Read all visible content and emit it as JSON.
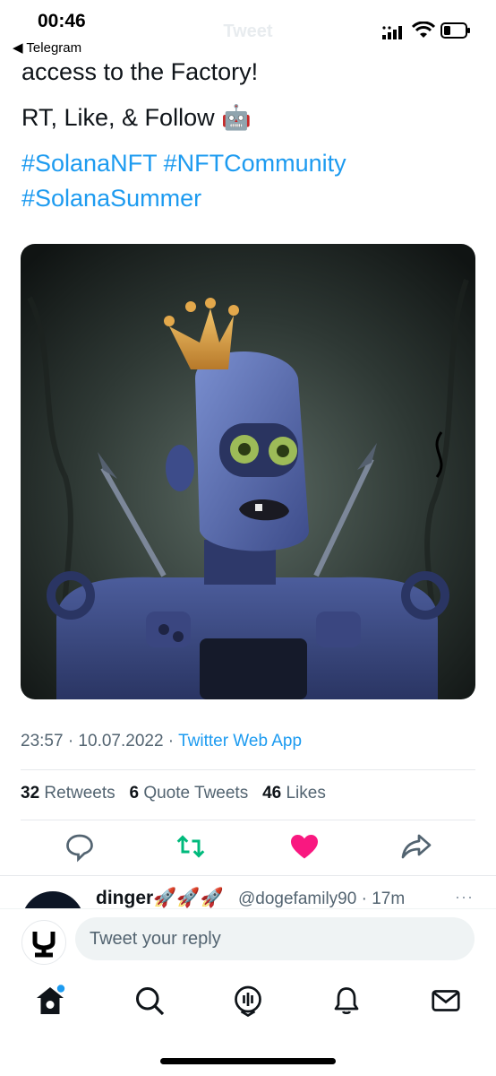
{
  "status_bar": {
    "time": "00:46",
    "back_app": "◀ Telegram",
    "ghost_title": "Tweet"
  },
  "tweet": {
    "lines": [
      "access to the Factory!",
      "RT, Like, & Follow 🤖"
    ],
    "hashtags_line1": "#SolanaNFT #NFTCommunity",
    "hashtags_line2": "#SolanaSummer",
    "image_description_icon": "robot-crown-nft",
    "timestamp": "23:57 · 10.07.2022 · ",
    "source": "Twitter Web App",
    "stats": {
      "retweets_count": "32",
      "retweets_label": "Retweets",
      "quotes_count": "6",
      "quotes_label": "Quote Tweets",
      "likes_count": "46",
      "likes_label": "Likes"
    },
    "liked": true
  },
  "reply": {
    "name": "dinger🚀🚀🚀",
    "handle": "@dogefamily90 · 17m",
    "more": "···"
  },
  "compose": {
    "placeholder": "Tweet your reply"
  },
  "nav": [
    "home-icon",
    "search-icon",
    "spaces-icon",
    "notifications-icon",
    "messages-icon"
  ],
  "colors": {
    "accent": "#1d9bf0",
    "like": "#f91880",
    "retweet": "#00ba7c"
  }
}
